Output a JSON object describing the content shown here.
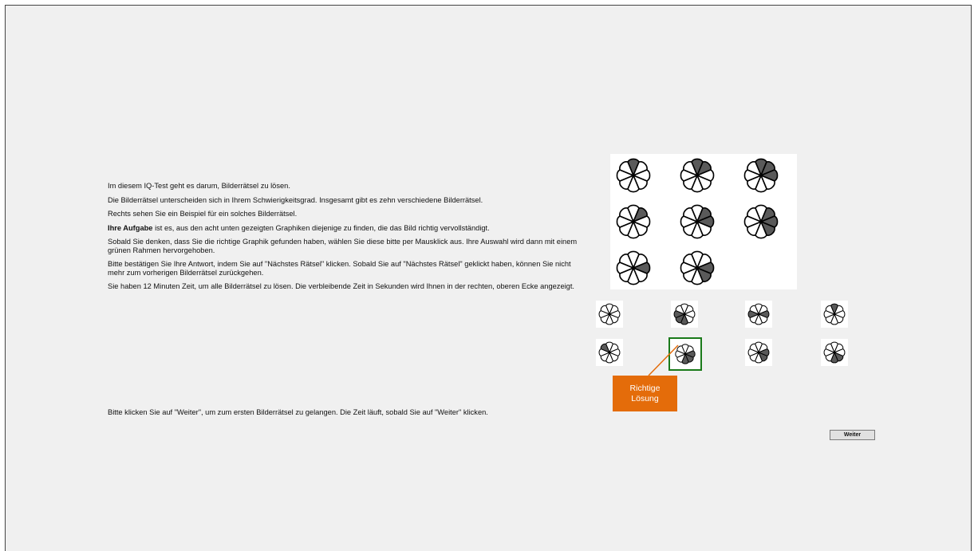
{
  "instructions": {
    "p1": "Im diesem IQ-Test geht es darum, Bilderrätsel zu lösen.",
    "p2": "Die Bilderrätsel unterscheiden sich in Ihrem Schwierigkeitsgrad. Insgesamt gibt es zehn verschiedene Bilderrätsel.",
    "p3": "Rechts sehen Sie ein Beispiel für ein solches Bilderrätsel.",
    "p4_bold": "Ihre Aufgabe",
    "p4_rest": " ist es, aus den acht unten gezeigten Graphiken diejenige zu finden, die das Bild richtig vervollständigt.",
    "p5": "Sobald Sie denken, dass Sie die richtige Graphik gefunden haben, wählen Sie diese bitte per Mausklick aus. Ihre Auswahl wird dann mit einem grünen Rahmen hervorgehoben.",
    "p6": "Bitte bestätigen Sie Ihre Antwort, indem Sie auf \"Nächstes Rätsel\" klicken. Sobald Sie auf \"Nächstes Rätsel\" geklickt haben, können Sie nicht mehr zum vorherigen Bilderrätsel zurückgehen.",
    "p7": "Sie haben 12 Minuten Zeit, um alle Bilderrätsel zu lösen. Die verbleibende Zeit in Sekunden wird Ihnen in der rechten, oberen Ecke angezeigt."
  },
  "footer_text": "Bitte klicken Sie auf \"Weiter\", um zum ersten Bilderrätsel zu gelangen. Die Zeit läuft, sobald Sie auf \"Weiter\" klicken.",
  "callout": {
    "line1": "Richtige",
    "line2": "Lösung"
  },
  "weiter_button": "Weiter",
  "colors": {
    "fill": "#5a5a5a",
    "selected_border": "#1a7a1a",
    "callout": "#e46c0a"
  },
  "puzzle": {
    "cells": [
      {
        "filled": [
          0
        ]
      },
      {
        "filled": [
          0,
          1
        ]
      },
      {
        "filled": [
          0,
          1,
          2
        ]
      },
      {
        "filled": [
          1
        ]
      },
      {
        "filled": [
          1,
          2
        ]
      },
      {
        "filled": [
          1,
          2,
          3
        ]
      },
      {
        "filled": [
          2
        ]
      },
      {
        "filled": [
          2,
          3
        ]
      }
    ]
  },
  "options": [
    {
      "filled": []
    },
    {
      "filled": [
        4,
        5,
        6
      ]
    },
    {
      "filled": [
        2,
        6
      ]
    },
    {
      "filled": [
        0
      ]
    },
    {
      "filled": [
        7
      ]
    },
    {
      "filled": [
        2,
        3,
        4
      ],
      "selected": true
    },
    {
      "filled": [
        2,
        3
      ]
    },
    {
      "filled": [
        3,
        4
      ]
    }
  ]
}
